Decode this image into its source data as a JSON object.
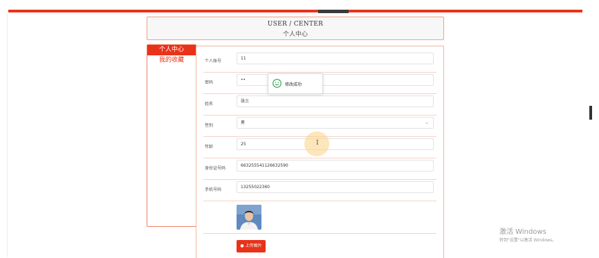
{
  "header": {
    "title_en": "USER / CENTER",
    "title_cn": "个人中心"
  },
  "sidebar": {
    "items": [
      {
        "label": "个人中心",
        "active": true
      },
      {
        "label": "我的收藏",
        "active": false
      }
    ]
  },
  "form": {
    "fields": [
      {
        "label": "个人账号",
        "value": "11"
      },
      {
        "label": "密码",
        "value": "••"
      },
      {
        "label": "姓名",
        "value": "张三"
      },
      {
        "label": "性别",
        "value": "男"
      },
      {
        "label": "年龄",
        "value": "25"
      },
      {
        "label": "身份证号码",
        "value": "663255541126632590"
      },
      {
        "label": "手机号码",
        "value": "13255022360"
      }
    ],
    "upload_label": "上传图片"
  },
  "toast": {
    "message": "修改成功",
    "icon": "smile-icon"
  },
  "watermark": {
    "title": "激活 Windows",
    "subtitle": "转到\"设置\"以激活 Windows。"
  },
  "colors": {
    "accent": "#e8321a",
    "border": "#f08060",
    "toast_icon": "#2aa24a"
  }
}
